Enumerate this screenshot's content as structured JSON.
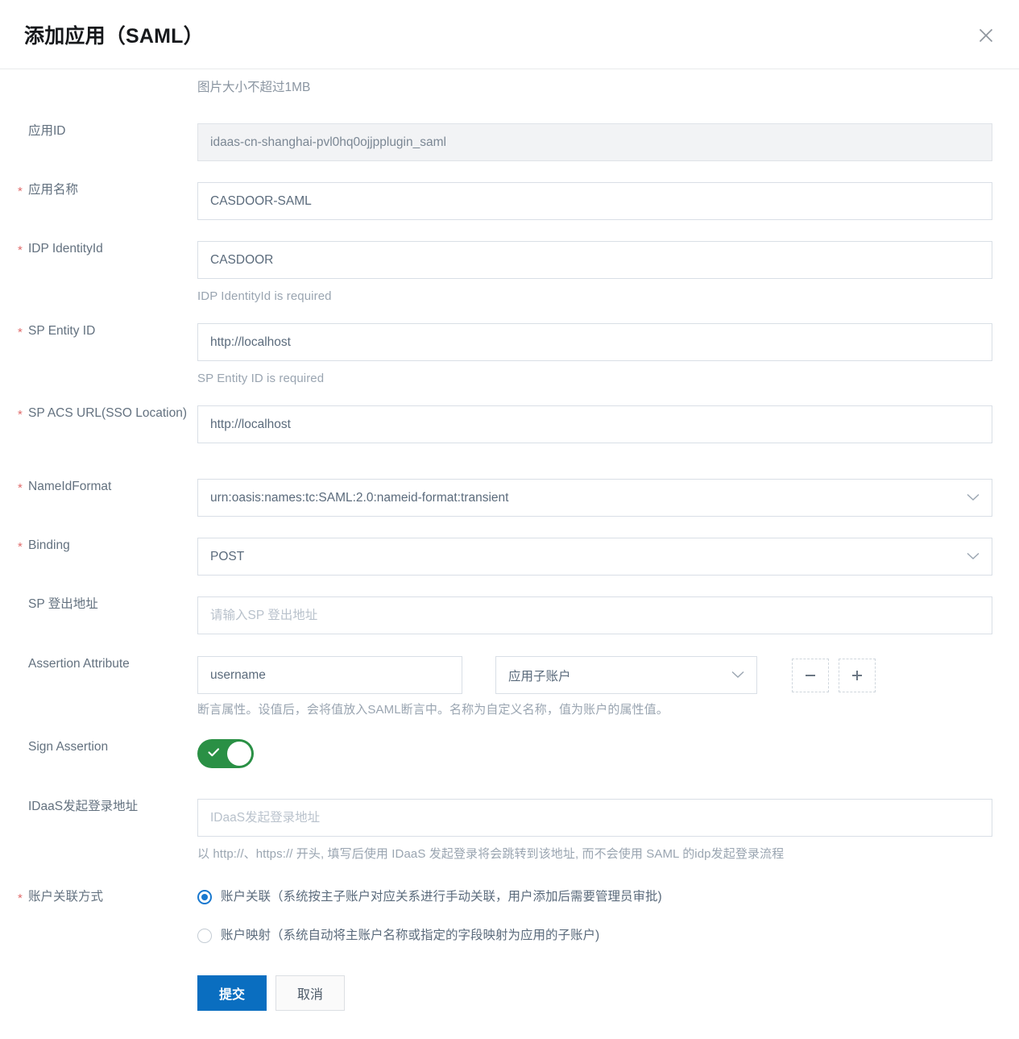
{
  "header": {
    "title": "添加应用（SAML）",
    "close_icon": "close-icon"
  },
  "form": {
    "upload_hint": "图片大小不超过1MB",
    "fields": {
      "app_id": {
        "label": "应用ID",
        "value": "idaas-cn-shanghai-pvl0hq0ojjpplugin_saml",
        "required": false,
        "disabled": true
      },
      "app_name": {
        "label": "应用名称",
        "value": "CASDOOR-SAML",
        "required": true
      },
      "idp_identity_id": {
        "label": "IDP IdentityId",
        "value": "CASDOOR",
        "required": true,
        "error": "IDP IdentityId is required"
      },
      "sp_entity_id": {
        "label": "SP Entity ID",
        "value": "http://localhost",
        "required": true,
        "error": "SP Entity ID is required"
      },
      "sp_acs_url": {
        "label": "SP ACS URL(SSO Location)",
        "value": "http://localhost",
        "required": true
      },
      "nameid_format": {
        "label": "NameIdFormat",
        "value": "urn:oasis:names:tc:SAML:2.0:nameid-format:transient",
        "required": true,
        "chevron_icon": "chevron-down-icon"
      },
      "binding": {
        "label": "Binding",
        "value": "POST",
        "required": true,
        "chevron_icon": "chevron-down-icon"
      },
      "sp_logout_url": {
        "label": "SP 登出地址",
        "value": "",
        "placeholder": "请输入SP 登出地址",
        "required": false
      },
      "assertion_attribute": {
        "label": "Assertion Attribute",
        "name_value": "username",
        "name_placeholder": "",
        "type_value": "应用子账户",
        "chevron_icon": "chevron-down-icon",
        "remove_label": "−",
        "add_label": "+",
        "helper": "断言属性。设值后，会将值放入SAML断言中。名称为自定义名称，值为账户的属性值。"
      },
      "sign_assertion": {
        "label": "Sign Assertion",
        "checked": true,
        "check_icon": "check-icon"
      },
      "idaas_login_url": {
        "label": "IDaaS发起登录地址",
        "value": "",
        "placeholder": "IDaaS发起登录地址",
        "helper": "以 http://、https:// 开头, 填写后使用 IDaaS 发起登录将会跳转到该地址, 而不会使用 SAML 的idp发起登录流程"
      },
      "account_link_mode": {
        "label": "账户关联方式",
        "required": true,
        "options": [
          {
            "label": "账户关联（系统按主子账户对应关系进行手动关联，用户添加后需要管理员审批)",
            "selected": true
          },
          {
            "label": "账户映射（系统自动将主账户名称或指定的字段映射为应用的子账户)",
            "selected": false
          }
        ]
      }
    },
    "actions": {
      "submit_label": "提交",
      "cancel_label": "取消"
    }
  },
  "colors": {
    "primary": "#0a6ec0",
    "toggle_on": "#2a9045",
    "required_star": "#e06c6c",
    "radio_checked": "#1878cf"
  }
}
